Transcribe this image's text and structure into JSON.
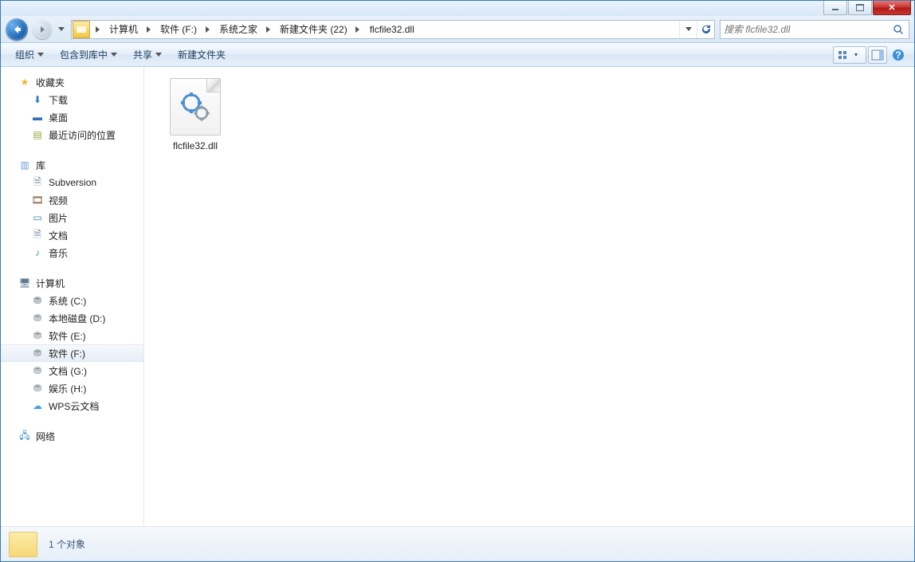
{
  "titlebar": {
    "min": "–",
    "max": "▢",
    "close": "✕"
  },
  "breadcrumbs": [
    "计算机",
    "软件 (F:)",
    "系统之家",
    "新建文件夹 (22)",
    "flcfile32.dll"
  ],
  "search": {
    "placeholder": "搜索 flcfile32.dll"
  },
  "toolbar": {
    "organize": "组织",
    "include": "包含到库中",
    "share": "共享",
    "newfolder": "新建文件夹"
  },
  "sidebar": {
    "favorites": {
      "label": "收藏夹",
      "items": [
        "下载",
        "桌面",
        "最近访问的位置"
      ]
    },
    "libraries": {
      "label": "库",
      "items": [
        "Subversion",
        "视频",
        "图片",
        "文档",
        "音乐"
      ]
    },
    "computer": {
      "label": "计算机",
      "items": [
        "系统 (C:)",
        "本地磁盘 (D:)",
        "软件 (E:)",
        "软件 (F:)",
        "文档 (G:)",
        "娱乐 (H:)",
        "WPS云文档"
      ],
      "selectedIndex": 3
    },
    "network": {
      "label": "网络"
    }
  },
  "files": [
    {
      "name": "flcfile32.dll"
    }
  ],
  "status": {
    "text": "1 个对象"
  }
}
